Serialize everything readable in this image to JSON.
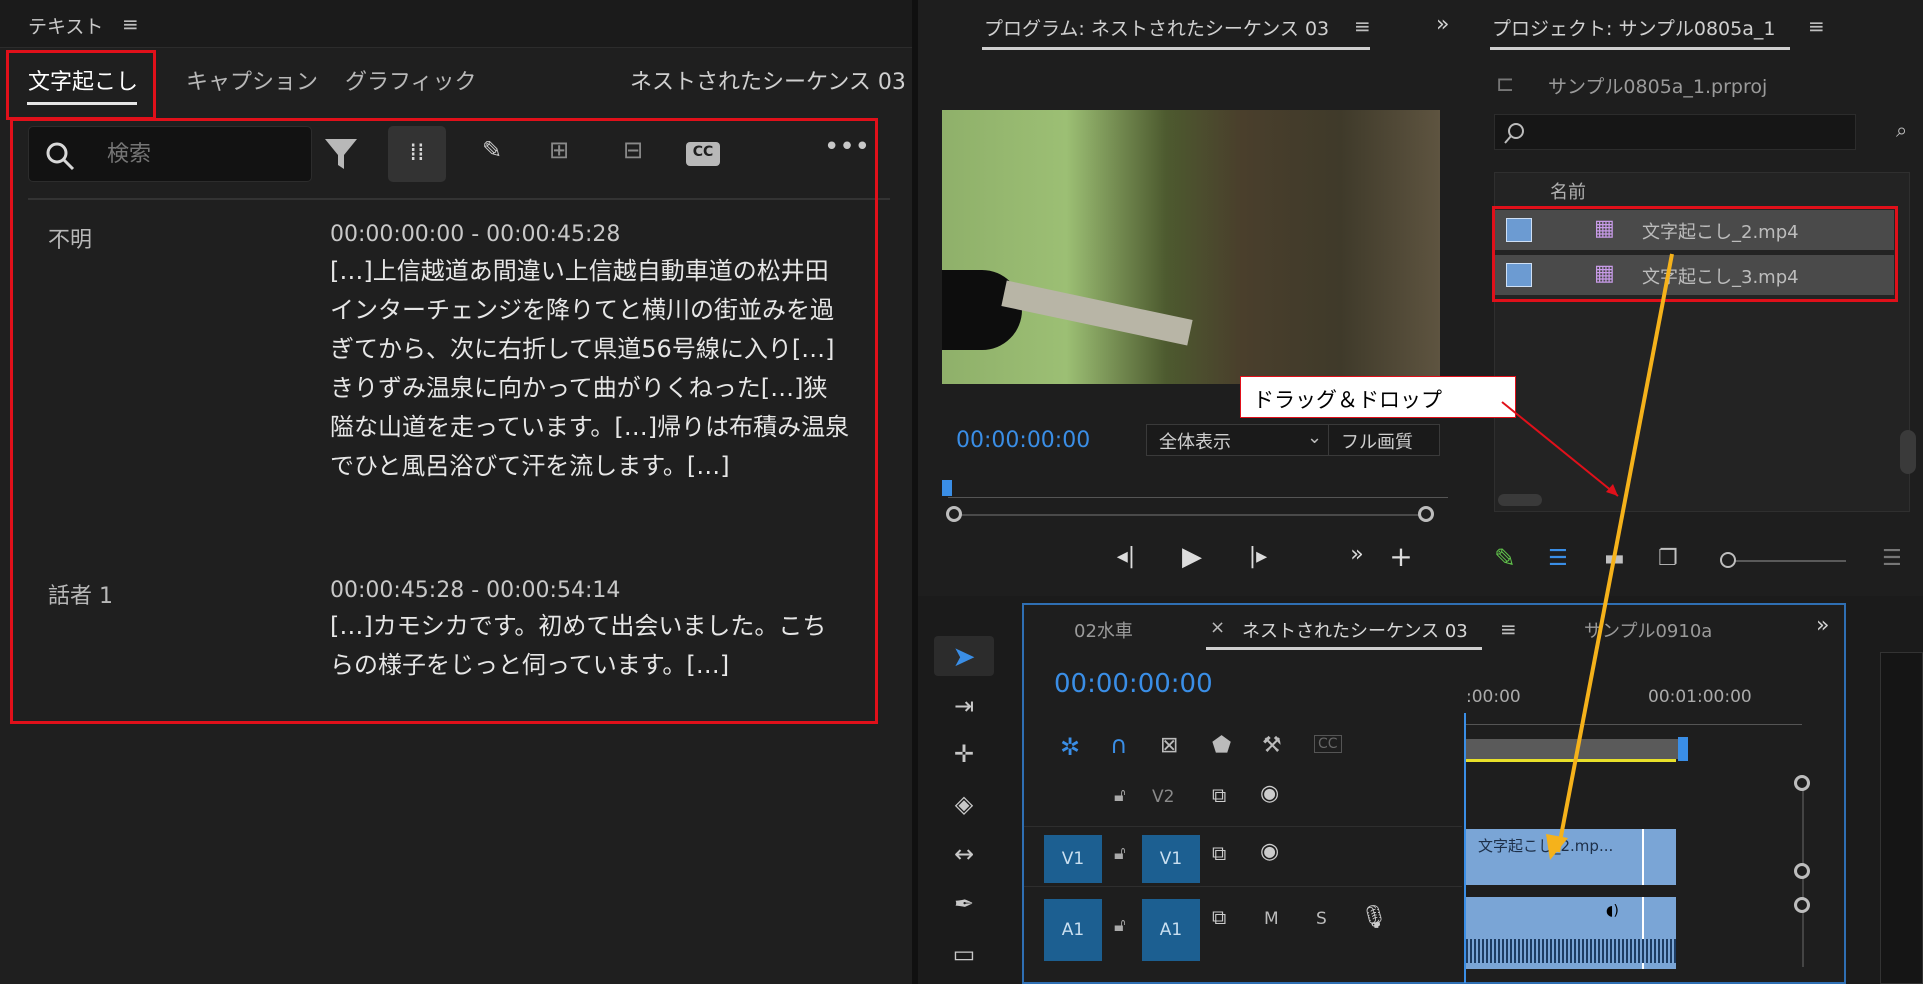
{
  "text_panel": {
    "title": "テキスト",
    "menu_icon": "hamburger-icon",
    "tabs": [
      "文字起こし",
      "キャプション",
      "グラフィック"
    ],
    "sequence_name": "ネストされたシーケンス 03",
    "search": {
      "placeholder": "検索"
    },
    "toolbar_icons": [
      "search-icon",
      "filter-icon",
      "split-icon",
      "pencil-icon",
      "merge-icon",
      "speaker-icon",
      "cc-icon",
      "more-icon"
    ],
    "cc_label": "CC",
    "segments": [
      {
        "speaker": "不明",
        "timecode": "00:00:00:00 - 00:00:45:28",
        "text": "[…]上信越道あ間違い上信越自動車道の松井田インターチェンジを降りてと横川の街並みを過ぎてから、次に右折して県道56号線に入り[…]きりずみ温泉に向かって曲がりくねった[…]狭隘な山道を走っています。[…]帰りは布積み温泉でひと風呂浴びて汗を流します。[…]"
      },
      {
        "speaker": "話者 1",
        "timecode": "00:00:45:28 - 00:00:54:14",
        "text": "[…]カモシカです。初めて出会いました。こちらの様子をじっと伺っています。[…]"
      }
    ]
  },
  "program_panel": {
    "title": "プログラム: ネストされたシーケンス 03",
    "timecode": "00:00:00:00",
    "zoom_select": "全体表示",
    "quality_select": "フル画質",
    "controls": [
      "step-back-icon",
      "play-icon",
      "step-forward-icon",
      "more-controls-icon",
      "add-icon"
    ]
  },
  "project_panel": {
    "title": "プロジェクト: サンプル0805a_1",
    "file_name": "サンプル0805a_1.prproj",
    "column_name": "名前",
    "items": [
      "文字起こし_2.mp4",
      "文字起こし_3.mp4"
    ],
    "annotation": "ドラッグ＆ドロップ"
  },
  "timeline_panel": {
    "tabs": [
      "02水車",
      "ネストされたシーケンス 03",
      "サンプル0910a"
    ],
    "timecode": "00:00:00:00",
    "ruler_labels": [
      ":00:00",
      "00:01:00:00"
    ],
    "tracks": [
      "V2",
      "V1",
      "A1"
    ],
    "track_source_v1": "V1",
    "track_source_a1": "A1",
    "mute_label": "M",
    "solo_label": "S",
    "clip_label": "文字起こし_2.mp..."
  },
  "colors": {
    "accent_blue": "#3a8ee6",
    "highlight_red": "#e0101a",
    "arrow_orange": "#f5b21b",
    "clip_blue": "#7aa5d6"
  }
}
